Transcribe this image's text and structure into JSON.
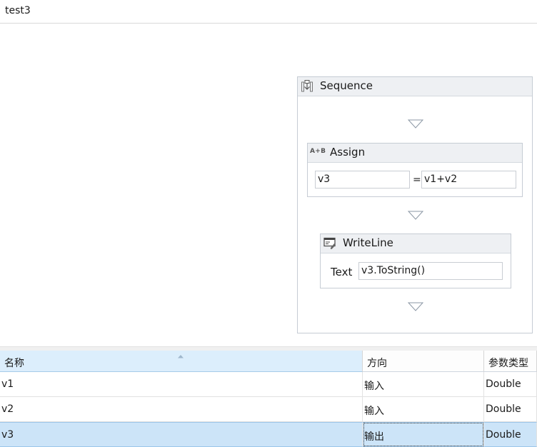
{
  "window": {
    "title": "test3"
  },
  "sequence": {
    "title": "Sequence",
    "icon": "sequence-icon",
    "assign": {
      "title": "Assign",
      "icon": "assign-icon",
      "icon_text": "A+B",
      "to": "v3",
      "operator": "=",
      "value": "v1+v2"
    },
    "writeline": {
      "title": "WriteLine",
      "icon": "writeline-icon",
      "text_label": "Text",
      "text_value": "v3.ToString()"
    },
    "drop_target_icon": "triangle-down-icon"
  },
  "arguments_grid": {
    "columns": [
      "名称",
      "方向",
      "参数类型"
    ],
    "sorted_column": 0,
    "rows": [
      {
        "name": "v1",
        "direction": "输入",
        "type": "Double",
        "selected": false
      },
      {
        "name": "v2",
        "direction": "输入",
        "type": "Double",
        "selected": false
      },
      {
        "name": "v3",
        "direction": "输出",
        "type": "Double",
        "selected": true
      }
    ]
  },
  "colors": {
    "selection": "#cce4f8",
    "header_sorted": "#dceefc",
    "activity_header": "#eef0f3",
    "border": "#c6ccd4"
  }
}
